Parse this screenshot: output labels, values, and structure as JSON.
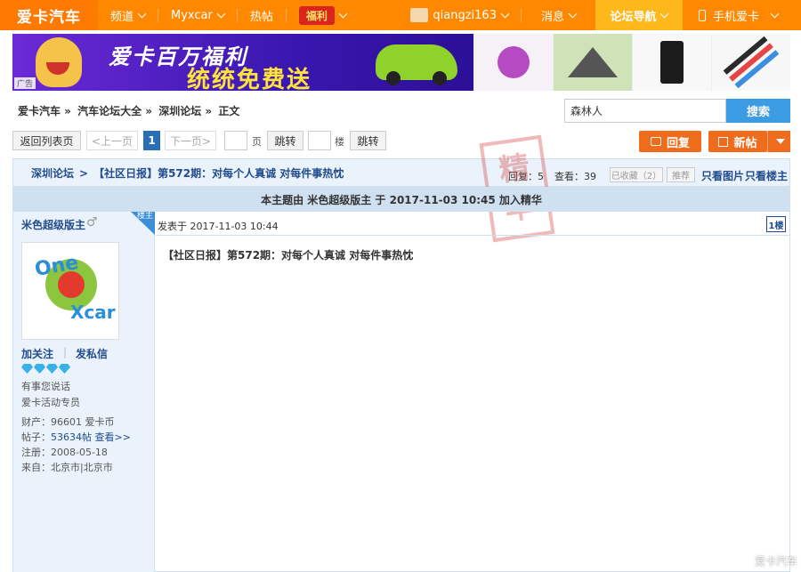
{
  "nav": {
    "logo": "爱卡汽车",
    "channel": "频道",
    "myxcar": "Myxcar",
    "hot": "热帖",
    "fuli": "福利",
    "user": "qiangzi163",
    "messages": "消息",
    "forum_nav": "论坛导航",
    "mobile": "手机爱卡"
  },
  "banner": {
    "title_line1": "爱卡百万福利",
    "title_line2": "统统免费送",
    "ad_label": "广告"
  },
  "breadcrumb": [
    "爱卡汽车 »",
    "汽车论坛大全 »",
    "深圳论坛 »",
    "正文"
  ],
  "search": {
    "value": "森林人",
    "button": "搜索"
  },
  "pager": {
    "back": "返回列表页",
    "prev": "<上一页",
    "current": "1",
    "next": "下一页>",
    "page_label": "页",
    "jump": "跳转",
    "floor_label": "楼",
    "jump2": "跳转"
  },
  "actions": {
    "reply": "回复",
    "new_post": "新帖"
  },
  "thread": {
    "forum": "深圳论坛",
    "title": "【社区日报】第572期：对每个人真诚 对每件事热忱",
    "replies": "回复：5",
    "views": "查看：39",
    "collected": "已收藏（2）",
    "recommend": "推荐",
    "only_images": "只看图片",
    "only_op": "只看楼主",
    "stamp_chars": [
      "精",
      "华"
    ]
  },
  "summary": "本主题由 米色超级版主 于 2017-11-03 10:45 加入精华",
  "author": {
    "name": "米色超级版主",
    "corner_tag": "楼主",
    "follow": "加关注",
    "message": "发私信",
    "motto": "有事您说话",
    "role": "爱卡活动专员",
    "wealth_label": "财产：",
    "wealth_value": "96601",
    "wealth_unit": "爱卡币",
    "posts_label": "帖子：",
    "posts_value": "53634帖",
    "posts_view": "查看>>",
    "reg_label": "注册：",
    "reg_value": "2008-05-18",
    "from_label": "来自：",
    "from_value": "北京市|北京市",
    "avatar_text1": "One",
    "avatar_text2": "Xcar"
  },
  "post": {
    "meta": "发表于 2017-11-03 10:44",
    "floor": "1楼",
    "title": "【社区日报】第572期：对每个人真诚 对每件事热忱"
  },
  "watermark": "爱卡汽车"
}
